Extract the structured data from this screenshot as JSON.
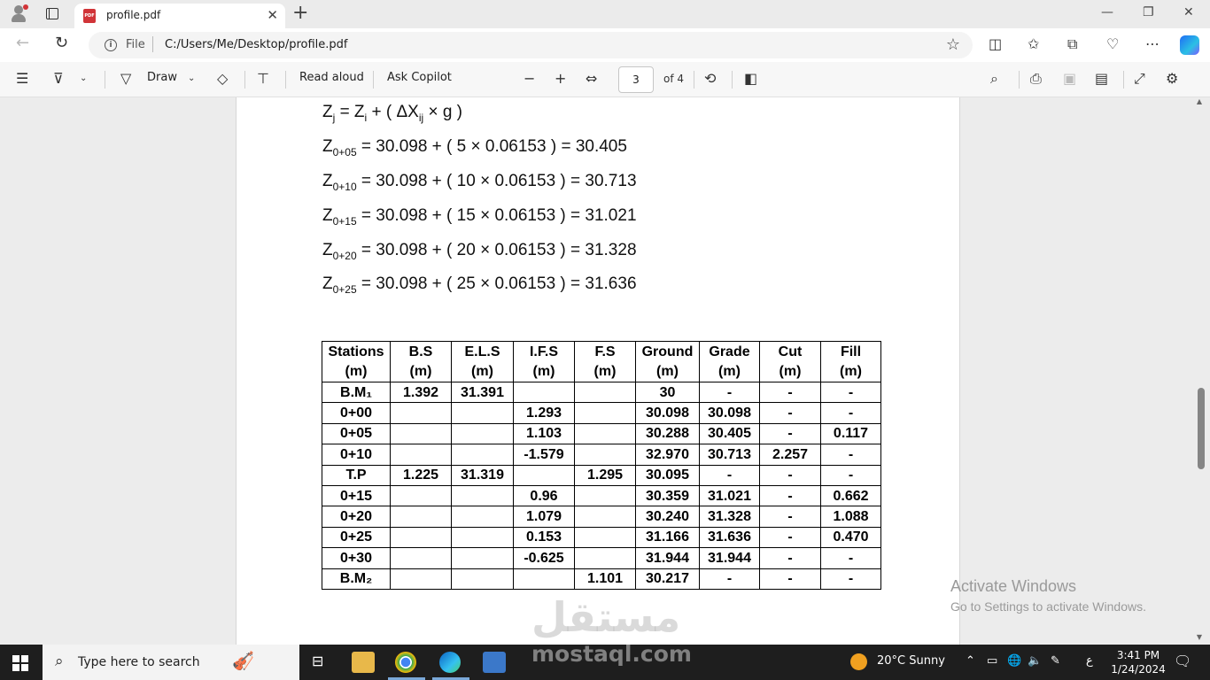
{
  "tab": {
    "title": "profile.pdf",
    "icon": "PDF"
  },
  "address": {
    "scheme": "File",
    "url": "C:/Users/Me/Desktop/profile.pdf"
  },
  "pdf_toolbar": {
    "draw_label": "Draw",
    "read_aloud_label": "Read aloud",
    "ask_copilot_label": "Ask Copilot",
    "page_current": "3",
    "page_total": "of 4"
  },
  "document": {
    "equations": [
      {
        "lhs": "Z",
        "lhs_sub": "j",
        "rhs": "= Z",
        "rhs_sub": "i",
        "tail": " + ( ΔX",
        "tail_sub": "ij",
        "end": " × g )"
      },
      {
        "lhs": "Z",
        "lhs_sub": "0+05",
        "rhs": " = 30.098 + ( 5 × 0.06153 ) = 30.405"
      },
      {
        "lhs": "Z",
        "lhs_sub": "0+10",
        "rhs": " = 30.098 + ( 10 × 0.06153 ) = 30.713"
      },
      {
        "lhs": "Z",
        "lhs_sub": "0+15",
        "rhs": " = 30.098 + ( 15 × 0.06153 ) = 31.021"
      },
      {
        "lhs": "Z",
        "lhs_sub": "0+20",
        "rhs": " = 30.098 + ( 20 × 0.06153 ) = 31.328"
      },
      {
        "lhs": "Z",
        "lhs_sub": "0+25",
        "rhs": " = 30.098 + ( 25 × 0.06153 ) = 31.636"
      }
    ],
    "table": {
      "headers": [
        [
          "Stations",
          "(m)"
        ],
        [
          "B.S",
          "(m)"
        ],
        [
          "E.L.S",
          "(m)"
        ],
        [
          "I.F.S",
          "(m)"
        ],
        [
          "F.S",
          "(m)"
        ],
        [
          "Ground",
          "(m)"
        ],
        [
          "Grade",
          "(m)"
        ],
        [
          "Cut",
          "(m)"
        ],
        [
          "Fill",
          "(m)"
        ]
      ],
      "rows": [
        [
          "B.M₁",
          "1.392",
          "31.391",
          "",
          "",
          "30",
          "-",
          "-",
          "-"
        ],
        [
          "0+00",
          "",
          "",
          "1.293",
          "",
          "30.098",
          "30.098",
          "-",
          "-"
        ],
        [
          "0+05",
          "",
          "",
          "1.103",
          "",
          "30.288",
          "30.405",
          "-",
          "0.117"
        ],
        [
          "0+10",
          "",
          "",
          "-1.579",
          "",
          "32.970",
          "30.713",
          "2.257",
          "-"
        ],
        [
          "T.P",
          "1.225",
          "31.319",
          "",
          "1.295",
          "30.095",
          "-",
          "-",
          "-"
        ],
        [
          "0+15",
          "",
          "",
          "0.96",
          "",
          "30.359",
          "31.021",
          "-",
          "0.662"
        ],
        [
          "0+20",
          "",
          "",
          "1.079",
          "",
          "30.240",
          "31.328",
          "-",
          "1.088"
        ],
        [
          "0+25",
          "",
          "",
          "0.153",
          "",
          "31.166",
          "31.636",
          "-",
          "0.470"
        ],
        [
          "0+30",
          "",
          "",
          "-0.625",
          "",
          "31.944",
          "31.944",
          "-",
          "-"
        ],
        [
          "B.M₂",
          "",
          "",
          "",
          "1.101",
          "30.217",
          "-",
          "-",
          "-"
        ]
      ]
    }
  },
  "watermark": {
    "activate_title": "Activate Windows",
    "activate_sub": "Go to Settings to activate Windows.",
    "brand_ar": "مستقل",
    "brand_en": "mostaql.com"
  },
  "taskbar": {
    "search_placeholder": "Type here to search",
    "weather": "20°C  Sunny",
    "lang": "ع",
    "time": "3:41 PM",
    "date": "1/24/2024"
  }
}
